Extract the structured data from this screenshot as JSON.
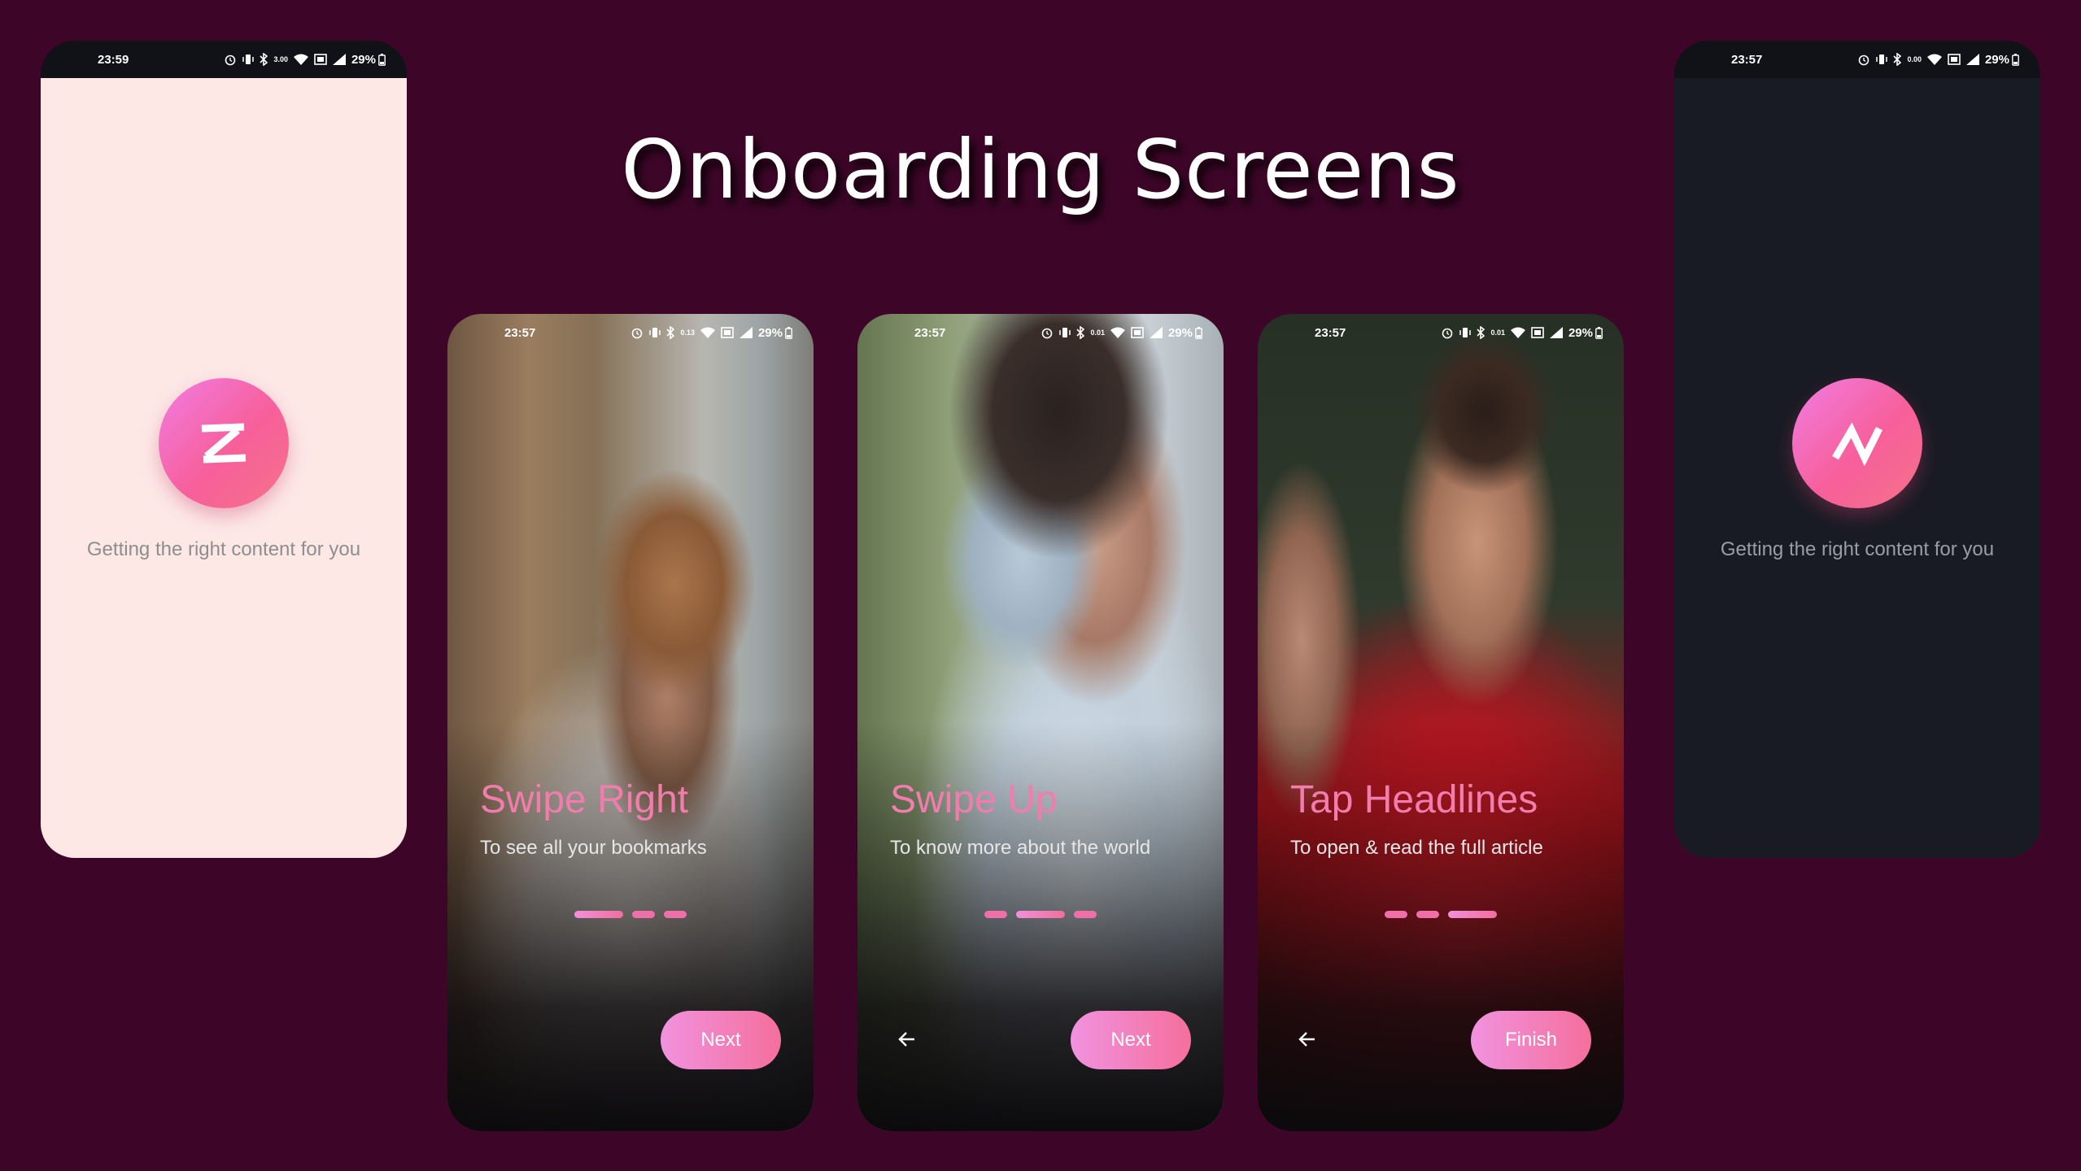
{
  "page_title": "Onboarding Screens",
  "status_bar": {
    "battery": "29%"
  },
  "splash_light": {
    "time": "23:59",
    "loading_text": "Getting the right content for you",
    "net_speed": "3.00"
  },
  "splash_dark": {
    "time": "23:57",
    "loading_text": "Getting the right content for you",
    "net_speed": "0.00"
  },
  "onboarding": [
    {
      "time": "23:57",
      "net_speed": "0.13",
      "title": "Swipe Right",
      "subtitle": "To see all your bookmarks",
      "active_page": 1,
      "button_label": "Next",
      "has_back": false
    },
    {
      "time": "23:57",
      "net_speed": "0.01",
      "title": "Swipe Up",
      "subtitle": "To know more about the world",
      "active_page": 2,
      "button_label": "Next",
      "has_back": true
    },
    {
      "time": "23:57",
      "net_speed": "0.01",
      "title": "Tap Headlines",
      "subtitle": "To open & read the full article",
      "active_page": 3,
      "button_label": "Finish",
      "has_back": true
    }
  ],
  "colors": {
    "background": "#3d0628",
    "accent_start": "#f292df",
    "accent_end": "#f46f9c",
    "title_pink": "#f07dac",
    "splash_light_bg": "#fde8e6",
    "splash_dark_bg": "#191b24"
  },
  "icons": [
    "alarm-icon",
    "vibrate-icon",
    "bluetooth-icon",
    "wifi-icon",
    "signal-icon",
    "battery-icon",
    "back-arrow-icon",
    "app-logo-icon"
  ]
}
